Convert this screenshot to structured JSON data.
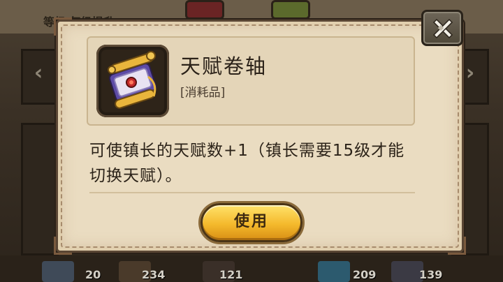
{
  "background": {
    "topbar_text": "等级 每级提升",
    "counts": [
      "20",
      "234",
      "121",
      "209",
      "139"
    ]
  },
  "dialog": {
    "item": {
      "name": "天赋卷轴",
      "type": "[消耗品]",
      "icon": "scroll-icon",
      "description": "可使镇长的天赋数+1（镇长需要15级才能切换天赋）。"
    },
    "use_button": {
      "label": "使用"
    },
    "close_button": {
      "icon": "close-x-icon"
    }
  },
  "colors": {
    "dialog_bg": "#eadcc1",
    "button_gold": "#f4b92c",
    "text_dark": "#2b2219"
  }
}
